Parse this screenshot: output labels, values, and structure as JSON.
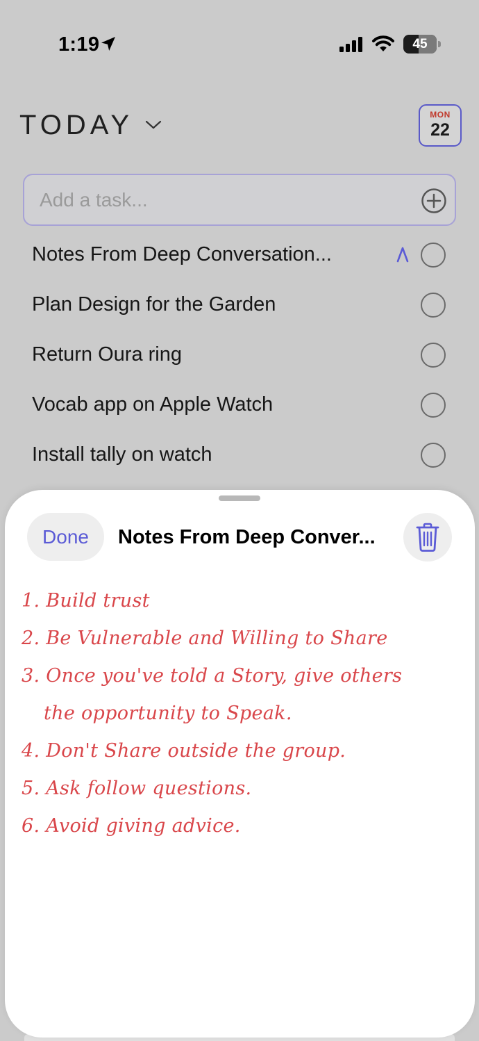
{
  "status_bar": {
    "time": "1:19",
    "battery": "45",
    "battery_level": 0.45
  },
  "header": {
    "title": "TODAY",
    "date_badge": {
      "day_of_week": "MON",
      "day": "22"
    }
  },
  "add_task": {
    "placeholder": "Add a task..."
  },
  "tasks": [
    {
      "label": "Notes From Deep Conversation...",
      "has_handwriting": true
    },
    {
      "label": "Plan Design for the Garden"
    },
    {
      "label": "Return Oura ring"
    },
    {
      "label": "Vocab app on Apple Watch"
    },
    {
      "label": "Install tally on watch"
    }
  ],
  "sheet": {
    "done_label": "Done",
    "title": "Notes From Deep Conver...",
    "notes": [
      "1. Build trust",
      "2. Be Vulnerable and Willing to Share",
      "3. Once you've told a Story, give others",
      "the opportunity to Speak.",
      "4. Don't Share outside the group.",
      "5. Ask follow questions.",
      "6. Avoid giving advice."
    ]
  },
  "colors": {
    "accent": "#5b5bd6",
    "ink": "#d9464a",
    "date_red": "#c0392b"
  }
}
